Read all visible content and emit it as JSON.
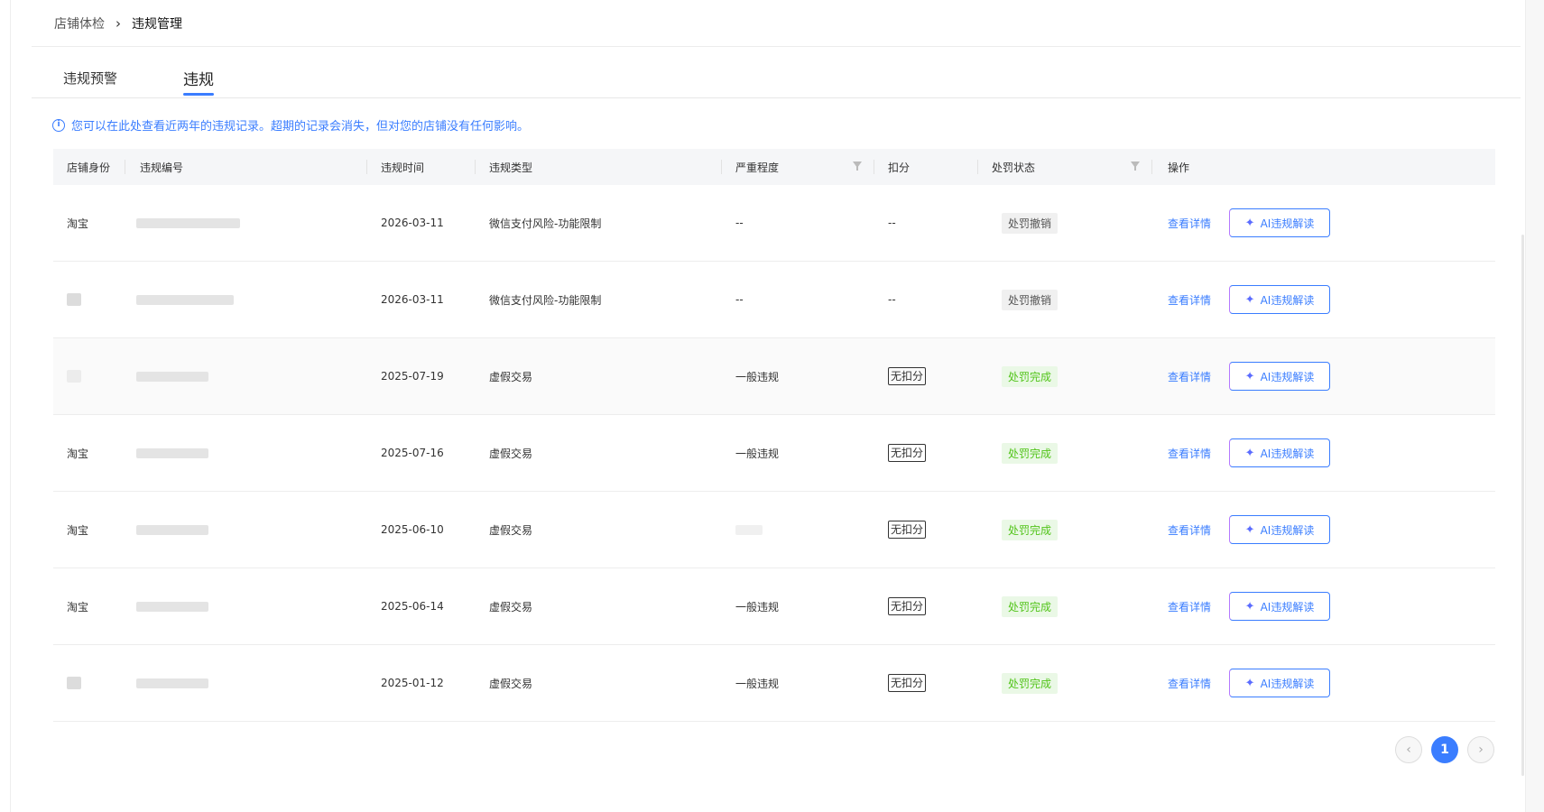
{
  "breadcrumb": {
    "parent": "店铺体检",
    "separator": "›",
    "current": "违规管理"
  },
  "tabs": [
    {
      "label": "违规预警"
    },
    {
      "label": "违规"
    }
  ],
  "notice": {
    "text": "您可以在此处查看近两年的违规记录。超期的记录会消失，但对您的店铺没有任何影响。"
  },
  "table": {
    "headers": {
      "shop_identity": "店铺身份",
      "violation_id": "违规编号",
      "violation_time": "违规时间",
      "violation_type": "违规类型",
      "severity": "严重程度",
      "deduction": "扣分",
      "penalty_status": "处罚状态",
      "actions": "操作"
    },
    "rows": [
      {
        "shop": "淘宝",
        "time": "2026-03-11",
        "type": "微信支付风险-功能限制",
        "severity": "--",
        "deduction": "--",
        "status": "处罚撤销",
        "status_kind": "gray"
      },
      {
        "shop": "",
        "time": "2026-03-11",
        "type": "微信支付风险-功能限制",
        "severity": "--",
        "deduction": "--",
        "status": "处罚撤销",
        "status_kind": "gray"
      },
      {
        "shop": "",
        "time": "2025-07-19",
        "type": "虚假交易",
        "severity": "一般违规",
        "deduction": "无扣分",
        "status": "处罚完成",
        "status_kind": "green"
      },
      {
        "shop": "淘宝",
        "time": "2025-07-16",
        "type": "虚假交易",
        "severity": "一般违规",
        "deduction": "无扣分",
        "status": "处罚完成",
        "status_kind": "green"
      },
      {
        "shop": "淘宝",
        "time": "2025-06-10",
        "type": "虚假交易",
        "severity": "",
        "deduction": "无扣分",
        "status": "处罚完成",
        "status_kind": "green"
      },
      {
        "shop": "淘宝",
        "time": "2025-06-14",
        "type": "虚假交易",
        "severity": "一般违规",
        "deduction": "无扣分",
        "status": "处罚完成",
        "status_kind": "green"
      },
      {
        "shop": "",
        "time": "2025-01-12",
        "type": "虚假交易",
        "severity": "一般违规",
        "deduction": "无扣分",
        "status": "处罚完成",
        "status_kind": "green"
      }
    ],
    "action_detail_label": "查看详情",
    "action_ai_label": "AI违规解读"
  },
  "pagination": {
    "prev": "‹",
    "current_page": "1",
    "next": "›"
  },
  "colors": {
    "accent": "#3a7dff",
    "success": "#52c41a",
    "ai_gradient_start": "#b478ff"
  }
}
